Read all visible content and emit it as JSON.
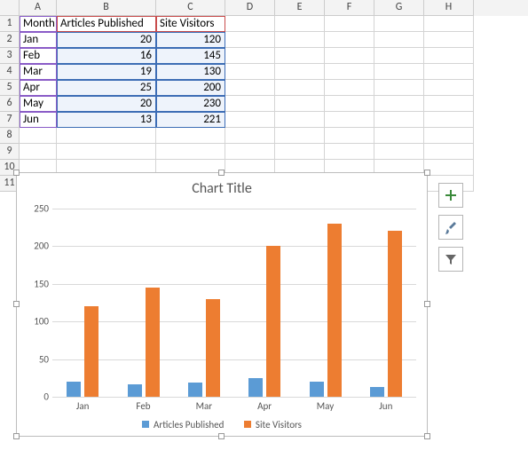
{
  "columns": [
    "A",
    "B",
    "C",
    "D",
    "E",
    "F",
    "G",
    "H"
  ],
  "headers": {
    "a": "Month",
    "b": "Articles Published",
    "c": "Site Visitors"
  },
  "rows": [
    {
      "m": "Jan",
      "a": 20,
      "v": 120
    },
    {
      "m": "Feb",
      "a": 16,
      "v": 145
    },
    {
      "m": "Mar",
      "a": 19,
      "v": 130
    },
    {
      "m": "Apr",
      "a": 25,
      "v": 200
    },
    {
      "m": "May",
      "a": 20,
      "v": 230
    },
    {
      "m": "Jun",
      "a": 13,
      "v": 221
    }
  ],
  "chart": {
    "title": "Chart Title",
    "legend": {
      "s1": "Articles Published",
      "s2": "Site Visitors"
    },
    "y_ticks": [
      "0",
      "50",
      "100",
      "150",
      "200",
      "250"
    ]
  },
  "side_buttons": {
    "add": "Chart Elements",
    "style": "Chart Styles",
    "filter": "Chart Filters"
  },
  "chart_data": {
    "type": "bar",
    "title": "Chart Title",
    "categories": [
      "Jan",
      "Feb",
      "Mar",
      "Apr",
      "May",
      "Jun"
    ],
    "series": [
      {
        "name": "Articles Published",
        "values": [
          20,
          16,
          19,
          25,
          20,
          13
        ]
      },
      {
        "name": "Site Visitors",
        "values": [
          120,
          145,
          130,
          200,
          230,
          221
        ]
      }
    ],
    "ylim": [
      0,
      250
    ],
    "xlabel": "",
    "ylabel": ""
  }
}
